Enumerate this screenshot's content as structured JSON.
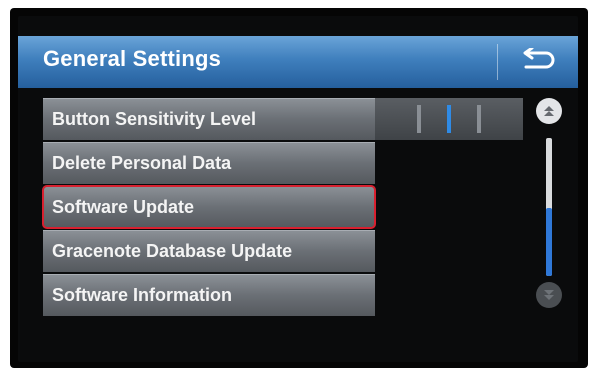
{
  "header": {
    "title": "General Settings",
    "back_icon": "back-arrow-icon"
  },
  "menu": {
    "items": [
      {
        "label": "Button Sensitivity Level",
        "selected": false
      },
      {
        "label": "Delete Personal Data",
        "selected": false
      },
      {
        "label": "Software Update",
        "selected": true
      },
      {
        "label": "Gracenote Database Update",
        "selected": false
      },
      {
        "label": "Software Information",
        "selected": false
      }
    ]
  },
  "sensitivity": {
    "levels": 3,
    "current_level": 2
  },
  "scroll": {
    "up_icon": "scroll-up-icon",
    "down_icon": "scroll-down-icon",
    "down_enabled": false,
    "position_fraction": 0.5
  },
  "colors": {
    "header": "#3f7fbd",
    "selection_outline": "#d8202f",
    "accent_blue": "#2f8be6"
  }
}
